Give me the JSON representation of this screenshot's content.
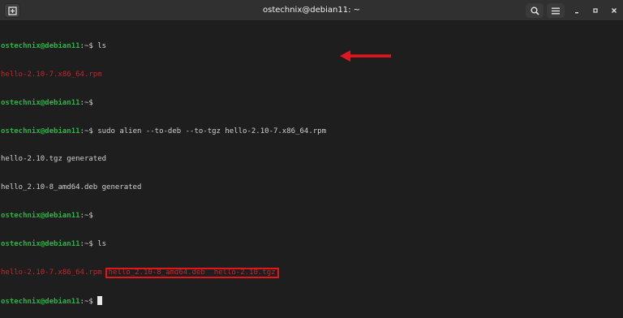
{
  "window": {
    "title": "ostechnix@debian11: ~"
  },
  "icons": {
    "new_tab": "new-tab-icon",
    "search": "search-icon",
    "menu": "hamburger-menu-icon",
    "minimize": "minimize-icon",
    "maximize": "maximize-icon",
    "close": "close-icon",
    "annotation_arrow": "red-arrow-icon"
  },
  "colors": {
    "background": "#1e1e1e",
    "prompt": "#2fb04a",
    "highlight_text": "#c4262c",
    "annotation": "#e4161c"
  },
  "terminal": {
    "prompt_user": "ostechnix@debian11",
    "prompt_path": ":~",
    "prompt_symbol": "$",
    "lines": [
      {
        "type": "prompt",
        "command": "ls"
      },
      {
        "type": "output_red",
        "text": "hello-2.10-7.x86_64.rpm"
      },
      {
        "type": "prompt",
        "command": ""
      },
      {
        "type": "prompt",
        "command": "sudo alien --to-deb --to-tgz hello-2.10-7.x86_64.rpm"
      },
      {
        "type": "output",
        "text": "hello-2.10.tgz generated"
      },
      {
        "type": "output",
        "text": "hello_2.10-8_amd64.deb generated"
      },
      {
        "type": "prompt",
        "command": ""
      },
      {
        "type": "prompt",
        "command": "ls"
      },
      {
        "type": "listing",
        "rpm": "hello-2.10-7.x86_64.rpm",
        "deb": "hello_2.10-8_amd64.deb",
        "tgz": "hello-2.10.tgz"
      },
      {
        "type": "prompt_cursor",
        "command": ""
      }
    ]
  }
}
